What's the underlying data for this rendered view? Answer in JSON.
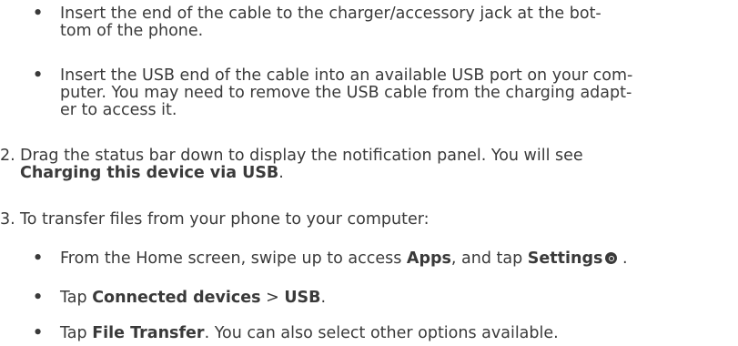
{
  "steps": {
    "sub1": {
      "bullet": "•",
      "line1": "Insert the end of the cable to the charger/accessory jack at the bot-",
      "line2": "tom of the phone."
    },
    "sub2": {
      "bullet": "•",
      "line1": "Insert the USB end of the cable into an available USB port on your com-",
      "line2": "puter. You may need to remove the USB cable from the charging adapt-",
      "line3": "er to access it."
    },
    "step2": {
      "number": "2.",
      "line1": "Drag the status bar down to display the notification panel. You will see",
      "bold_text": "Charging this device via USB",
      "end_text": "."
    },
    "step3": {
      "number": "3.",
      "line1": "To transfer files from your phone to your computer:"
    },
    "sub3": {
      "bullet": "•",
      "prefix": "From the Home screen, swipe up to access ",
      "apps": "Apps",
      "middle": ", and tap ",
      "settings": "Settings",
      "suffix": " .",
      "icon": "settings-icon"
    },
    "sub4": {
      "bullet": "•",
      "prefix": "Tap ",
      "connected": "Connected devices",
      "sep": " > ",
      "usb": "USB",
      "suffix": "."
    },
    "sub5": {
      "bullet": "•",
      "prefix": "Tap ",
      "file_transfer": "File Transfer",
      "suffix": ". You can also select other options available."
    }
  }
}
